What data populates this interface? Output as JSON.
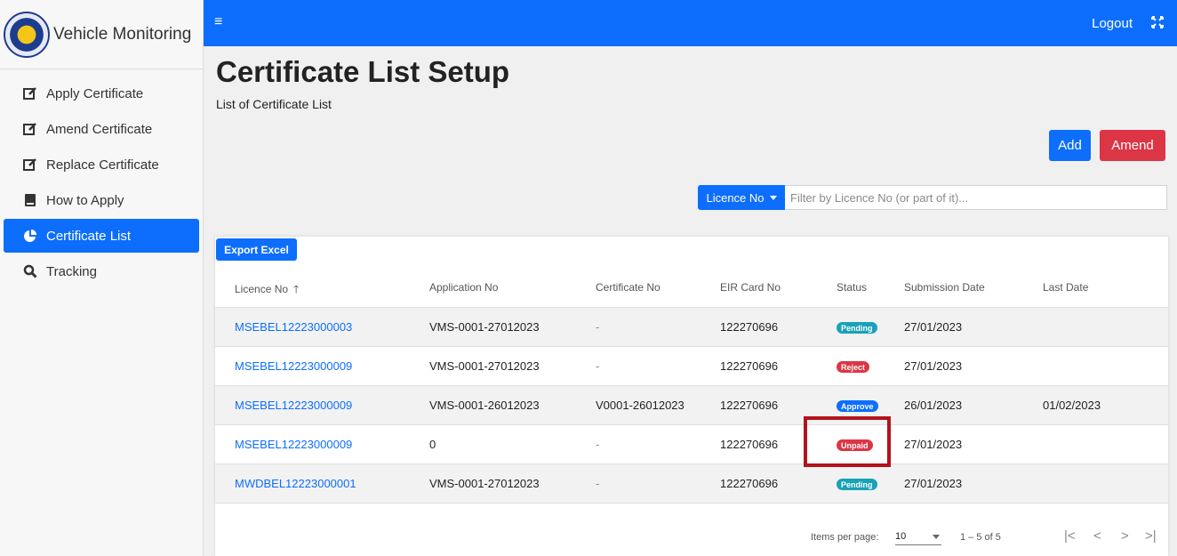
{
  "sidebar": {
    "title": "Vehicle Monitoring",
    "items": [
      {
        "label": "Apply Certificate",
        "icon": "edit-icon"
      },
      {
        "label": "Amend Certificate",
        "icon": "edit-icon"
      },
      {
        "label": "Replace Certificate",
        "icon": "edit-icon"
      },
      {
        "label": "How to Apply",
        "icon": "book-icon"
      },
      {
        "label": "Certificate List",
        "icon": "pie-chart-icon",
        "active": true
      },
      {
        "label": "Tracking",
        "icon": "search-icon"
      }
    ]
  },
  "topbar": {
    "menu_icon": "≡",
    "logout_label": "Logout"
  },
  "page": {
    "title": "Certificate List Setup",
    "subtitle": "List of Certificate List",
    "add_label": "Add",
    "amend_label": "Amend"
  },
  "filter": {
    "button_label": "Licence No",
    "placeholder": "Filter by Licence No (or part of it)..."
  },
  "table": {
    "export_label": "Export Excel",
    "headers": [
      "Licence No",
      "Application No",
      "Certificate No",
      "EIR Card No",
      "Status",
      "Submission Date",
      "Last Date"
    ],
    "sort_indicator": "🡑",
    "rows": [
      {
        "licence": "MSEBEL12223000003",
        "application": "VMS-0001-27012023",
        "certificate": "-",
        "eir": "122270696",
        "status": "Pending",
        "submission": "27/01/2023",
        "last": ""
      },
      {
        "licence": "MSEBEL12223000009",
        "application": "VMS-0001-27012023",
        "certificate": "-",
        "eir": "122270696",
        "status": "Reject",
        "submission": "27/01/2023",
        "last": ""
      },
      {
        "licence": "MSEBEL12223000009",
        "application": "VMS-0001-26012023",
        "certificate": "V0001-26012023",
        "eir": "122270696",
        "status": "Approve",
        "submission": "26/01/2023",
        "last": "01/02/2023"
      },
      {
        "licence": "MSEBEL12223000009",
        "application": "0",
        "certificate": "-",
        "eir": "122270696",
        "status": "Unpaid",
        "submission": "27/01/2023",
        "last": ""
      },
      {
        "licence": "MWDBEL12223000001",
        "application": "VMS-0001-27012023",
        "certificate": "-",
        "eir": "122270696",
        "status": "Pending",
        "submission": "27/01/2023",
        "last": ""
      }
    ]
  },
  "status_colors": {
    "Pending": "#17a2b8",
    "Reject": "#dc3545",
    "Approve": "#0d6efd",
    "Unpaid": "#dc3545"
  },
  "paginator": {
    "items_per_page_label": "Items per page:",
    "page_size": "10",
    "range_label": "1 – 5 of 5",
    "first": "|<",
    "prev": "<",
    "next": ">",
    "last": ">|"
  },
  "colors": {
    "primary": "#0d6efd",
    "danger": "#dc3545",
    "highlight": "#b3131b"
  }
}
